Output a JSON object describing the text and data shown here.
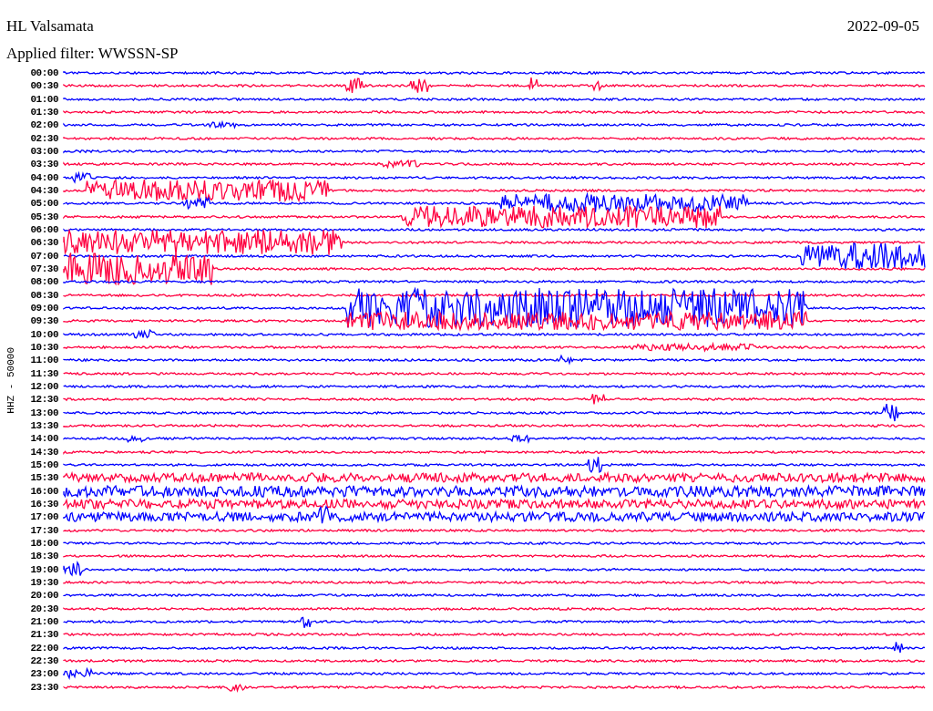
{
  "header": {
    "station": "HL Valsamata",
    "date": "2022-09-05",
    "filter": "Applied filter: WWSSN-SP"
  },
  "axis_label": "HHZ - 50000",
  "rows": [
    {
      "time": "00:00",
      "color": "#0000ff"
    },
    {
      "time": "00:30",
      "color": "#ff0040"
    },
    {
      "time": "01:00",
      "color": "#0000ff"
    },
    {
      "time": "01:30",
      "color": "#ff0040"
    },
    {
      "time": "02:00",
      "color": "#0000ff"
    },
    {
      "time": "02:30",
      "color": "#ff0040"
    },
    {
      "time": "03:00",
      "color": "#0000ff"
    },
    {
      "time": "03:30",
      "color": "#ff0040"
    },
    {
      "time": "04:00",
      "color": "#0000ff"
    },
    {
      "time": "04:30",
      "color": "#ff0040"
    },
    {
      "time": "05:00",
      "color": "#0000ff"
    },
    {
      "time": "05:30",
      "color": "#ff0040"
    },
    {
      "time": "06:00",
      "color": "#0000ff"
    },
    {
      "time": "06:30",
      "color": "#ff0040"
    },
    {
      "time": "07:00",
      "color": "#0000ff"
    },
    {
      "time": "07:30",
      "color": "#ff0040"
    },
    {
      "time": "08:00",
      "color": "#0000ff"
    },
    {
      "time": "08:30",
      "color": "#ff0040"
    },
    {
      "time": "09:00",
      "color": "#0000ff"
    },
    {
      "time": "09:30",
      "color": "#ff0040"
    },
    {
      "time": "10:00",
      "color": "#0000ff"
    },
    {
      "time": "10:30",
      "color": "#ff0040"
    },
    {
      "time": "11:00",
      "color": "#0000ff"
    },
    {
      "time": "11:30",
      "color": "#ff0040"
    },
    {
      "time": "12:00",
      "color": "#0000ff"
    },
    {
      "time": "12:30",
      "color": "#ff0040"
    },
    {
      "time": "13:00",
      "color": "#0000ff"
    },
    {
      "time": "13:30",
      "color": "#ff0040"
    },
    {
      "time": "14:00",
      "color": "#0000ff"
    },
    {
      "time": "14:30",
      "color": "#ff0040"
    },
    {
      "time": "15:00",
      "color": "#0000ff"
    },
    {
      "time": "15:30",
      "color": "#ff0040"
    },
    {
      "time": "16:00",
      "color": "#0000ff"
    },
    {
      "time": "16:30",
      "color": "#ff0040"
    },
    {
      "time": "17:00",
      "color": "#0000ff"
    },
    {
      "time": "17:30",
      "color": "#ff0040"
    },
    {
      "time": "18:00",
      "color": "#0000ff"
    },
    {
      "time": "18:30",
      "color": "#ff0040"
    },
    {
      "time": "19:00",
      "color": "#0000ff"
    },
    {
      "time": "19:30",
      "color": "#ff0040"
    },
    {
      "time": "20:00",
      "color": "#0000ff"
    },
    {
      "time": "20:30",
      "color": "#ff0040"
    },
    {
      "time": "21:00",
      "color": "#0000ff"
    },
    {
      "time": "21:30",
      "color": "#ff0040"
    },
    {
      "time": "22:00",
      "color": "#0000ff"
    },
    {
      "time": "22:30",
      "color": "#ff0040"
    },
    {
      "time": "23:00",
      "color": "#0000ff"
    },
    {
      "time": "23:30",
      "color": "#ff0040"
    }
  ]
}
